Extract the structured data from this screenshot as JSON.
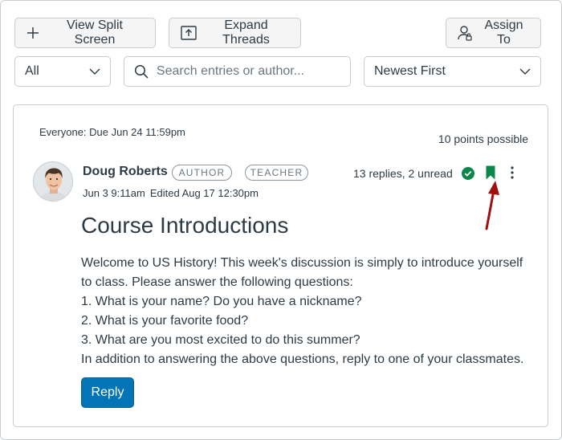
{
  "toolbar": {
    "split_label": "View Split Screen",
    "expand_label": "Expand Threads",
    "assign_label": "Assign To"
  },
  "filters": {
    "filter_value": "All",
    "search_placeholder": "Search entries or author...",
    "sort_value": "Newest First"
  },
  "discussion": {
    "due": "Everyone: Due Jun 24 11:59pm",
    "points": "10 points possible",
    "author": "Doug Roberts",
    "roles": [
      "AUTHOR",
      "TEACHER"
    ],
    "posted": "Jun 3 9:11am",
    "edited": "Edited Aug 17 12:30pm",
    "replies": "13 replies, 2 unread",
    "title": "Course Introductions",
    "body": [
      "Welcome to US History! This week's discussion is simply to introduce yourself",
      "to class. Please answer the following questions:",
      "1. What is your name? Do you have a nickname?",
      "2. What is your favorite food?",
      "3. What are you most excited to do this summer?",
      "In addition to answering the above questions, reply to one of your classmates."
    ],
    "reply_label": "Reply"
  },
  "colors": {
    "primary": "#0374B5",
    "success": "#0B874B",
    "annotation_arrow": "#A01010",
    "text": "#2D3B45",
    "border": "#C7CDD1"
  },
  "icons": [
    "plus-icon",
    "expand-icon",
    "assign-user-icon",
    "chevron-down-icon",
    "search-icon",
    "check-circle-icon",
    "bookmark-icon",
    "kebab-icon"
  ]
}
